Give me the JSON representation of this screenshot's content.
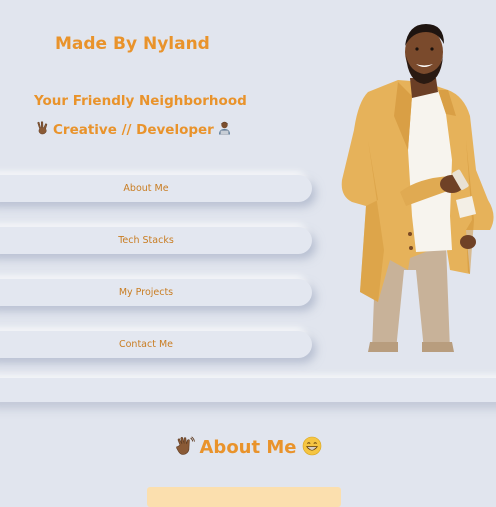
{
  "hero": {
    "brand": "Made By Nyland",
    "tagline": "Your Friendly Neighborhood",
    "role": "Creative // Developer",
    "role_prefix_icon": "victory-hand-emoji",
    "role_suffix_icon": "technologist-emoji"
  },
  "nav": {
    "items": [
      {
        "label": "About Me"
      },
      {
        "label": "Tech Stacks"
      },
      {
        "label": "My Projects"
      },
      {
        "label": "Contact Me"
      }
    ]
  },
  "photo": {
    "subject": "portrait-photo"
  },
  "about": {
    "heading": "About Me",
    "heading_prefix_icon": "waving-hand-emoji",
    "heading_suffix_icon": "grinning-face-emoji"
  },
  "colors": {
    "accent": "#e9932b",
    "background": "#e1e5ee",
    "card": "#fbdfae"
  }
}
